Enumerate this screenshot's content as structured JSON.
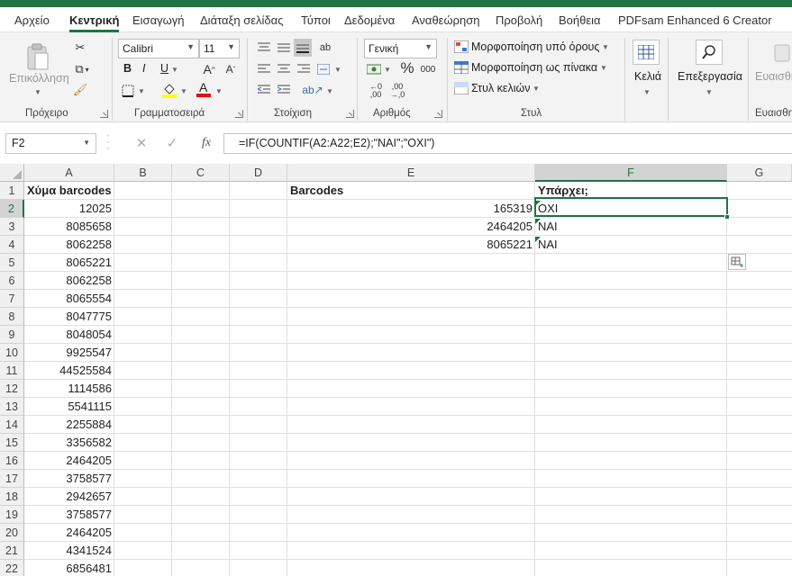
{
  "tabs": [
    "Αρχείο",
    "Κεντρική",
    "Εισαγωγή",
    "Διάταξη σελίδας",
    "Τύποι",
    "Δεδομένα",
    "Αναθεώρηση",
    "Προβολή",
    "Βοήθεια",
    "PDFsam Enhanced 6 Creator"
  ],
  "active_tab": "Κεντρική",
  "ribbon": {
    "clipboard": {
      "label": "Πρόχειρο",
      "paste": "Επικόλληση"
    },
    "font": {
      "label": "Γραμματοσειρά",
      "name": "Calibri",
      "size": "11",
      "bold": "B",
      "italic": "I",
      "underline": "U"
    },
    "alignment": {
      "label": "Στοίχιση"
    },
    "number": {
      "label": "Αριθμός",
      "format": "Γενική"
    },
    "styles": {
      "label": "Στυλ",
      "conditional": "Μορφοποίηση υπό όρους",
      "as_table": "Μορφοποίηση ως πίνακα",
      "cell_styles": "Στυλ κελιών"
    },
    "cells": {
      "label": "Κελιά"
    },
    "editing": {
      "label": "Επεξεργασία"
    },
    "sensitivity": {
      "label": "Ευαισθησ",
      "label_top": "Ευαισθη"
    }
  },
  "formula_bar": {
    "name_box": "F2",
    "fx": "fx",
    "formula": "=IF(COUNTIF(A2:A22;E2);\"ΝΑΙ\";\"ΟΧΙ\")"
  },
  "columns": [
    "A",
    "B",
    "C",
    "D",
    "E",
    "F",
    "G"
  ],
  "selected_cell": {
    "col": "F",
    "row": 2
  },
  "rows": [
    1,
    2,
    3,
    4,
    5,
    6,
    7,
    8,
    9,
    10,
    11,
    12,
    13,
    14,
    15,
    16,
    17,
    18,
    19,
    20,
    21,
    22
  ],
  "cells": {
    "A1": "Χύμα barcodes",
    "E1": "Barcodes",
    "F1": "Υπάρχει;",
    "colA": [
      "12025",
      "8085658",
      "8062258",
      "8065221",
      "8062258",
      "8065554",
      "8047775",
      "8048054",
      "9925547",
      "44525584",
      "1114586",
      "5541115",
      "2255884",
      "3356582",
      "2464205",
      "3758577",
      "2942657",
      "3758577",
      "2464205",
      "4341524",
      "6856481"
    ],
    "colE": [
      "165319",
      "2464205",
      "8065221"
    ],
    "colF": [
      "ΟΧΙ",
      "ΝΑΙ",
      "ΝΑΙ"
    ]
  }
}
